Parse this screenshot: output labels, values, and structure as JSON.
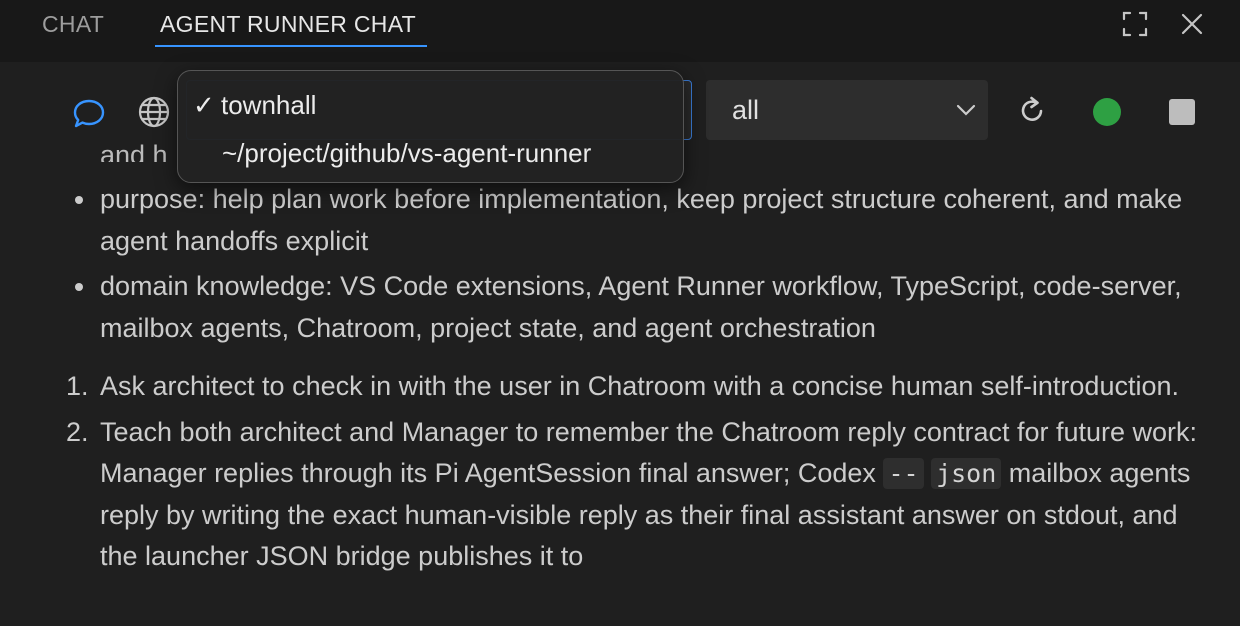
{
  "tabs": [
    {
      "label": "CHAT",
      "active": false
    },
    {
      "label": "AGENT RUNNER CHAT",
      "active": true
    }
  ],
  "window_controls": {
    "maximize_icon": "maximize-icon",
    "close_icon": "close-icon"
  },
  "toolbar": {
    "chat_icon": "chat-bubble-icon",
    "globe_icon": "globe-icon",
    "session_select": {
      "options": [
        "townhall",
        "~/project/github/vs-agent-runner"
      ],
      "selected": "townhall",
      "check_mark": "✓"
    },
    "filter_select": {
      "value": "all"
    },
    "refresh_icon": "refresh-icon",
    "status_dot_color": "#2ea043",
    "stop_icon": "stop-icon"
  },
  "message": {
    "partial_line": "and h",
    "bullets": [
      "purpose: help plan work before implementation, keep project structure coherent, and make agent handoffs explicit",
      "domain knowledge: VS Code extensions, Agent Runner workflow, TypeScript, code-server, mailbox agents, Chatroom, project state, and agent orchestration"
    ],
    "steps": [
      {
        "number": "1.",
        "text": "Ask architect to check in with the user in Chatroom with a concise human self-introduction."
      },
      {
        "number": "2.",
        "text_before_code1": "Teach both architect and Manager to remember the Chatroom reply contract for future work: Manager replies through its Pi AgentSession final answer; Codex ",
        "code1": "--",
        "code2": "json",
        "text_after_code": " mailbox agents reply by writing the exact human-visible reply as their final assistant answer on stdout, and the launcher JSON bridge publishes it to"
      }
    ]
  },
  "colors": {
    "accent": "#3794ff",
    "background": "#1f1f1f",
    "tabbar": "#181818",
    "chat_icon": "#3794ff",
    "status_running": "#2ea043"
  }
}
